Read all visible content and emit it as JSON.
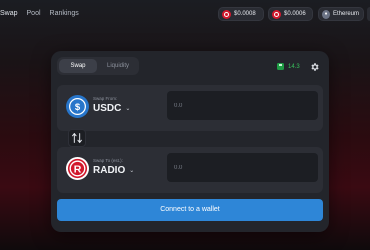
{
  "nav": {
    "swap": "Swap",
    "pool": "Pool",
    "rankings": "Rankings"
  },
  "header": {
    "balances": [
      {
        "value": "$0.0008",
        "icon": "radio-token-icon"
      },
      {
        "value": "$0.0006",
        "icon": "radio-token-icon"
      }
    ],
    "network": {
      "label": "Ethereum",
      "icon": "ethereum-icon"
    }
  },
  "card": {
    "tabs": {
      "swap": "Swap",
      "liquidity": "Liquidity"
    },
    "gas": {
      "value": "14.3",
      "icon": "gas-pump-icon",
      "color": "#38c15c"
    },
    "settings_icon": "gear-icon",
    "from": {
      "label": "Swap From:",
      "token": "USDC",
      "amount_placeholder": "0.0",
      "icon": "usdc-icon"
    },
    "to": {
      "label": "Swap To (est.):",
      "token": "RADIO",
      "amount_placeholder": "0.0",
      "icon": "radio-icon"
    },
    "switch_icon": "swap-arrows-icon",
    "connect_label": "Connect to a wallet"
  },
  "colors": {
    "accent": "#2e86d7",
    "card": "#23252b",
    "radio_red": "#d2182c",
    "usdc_blue": "#2775ca"
  }
}
